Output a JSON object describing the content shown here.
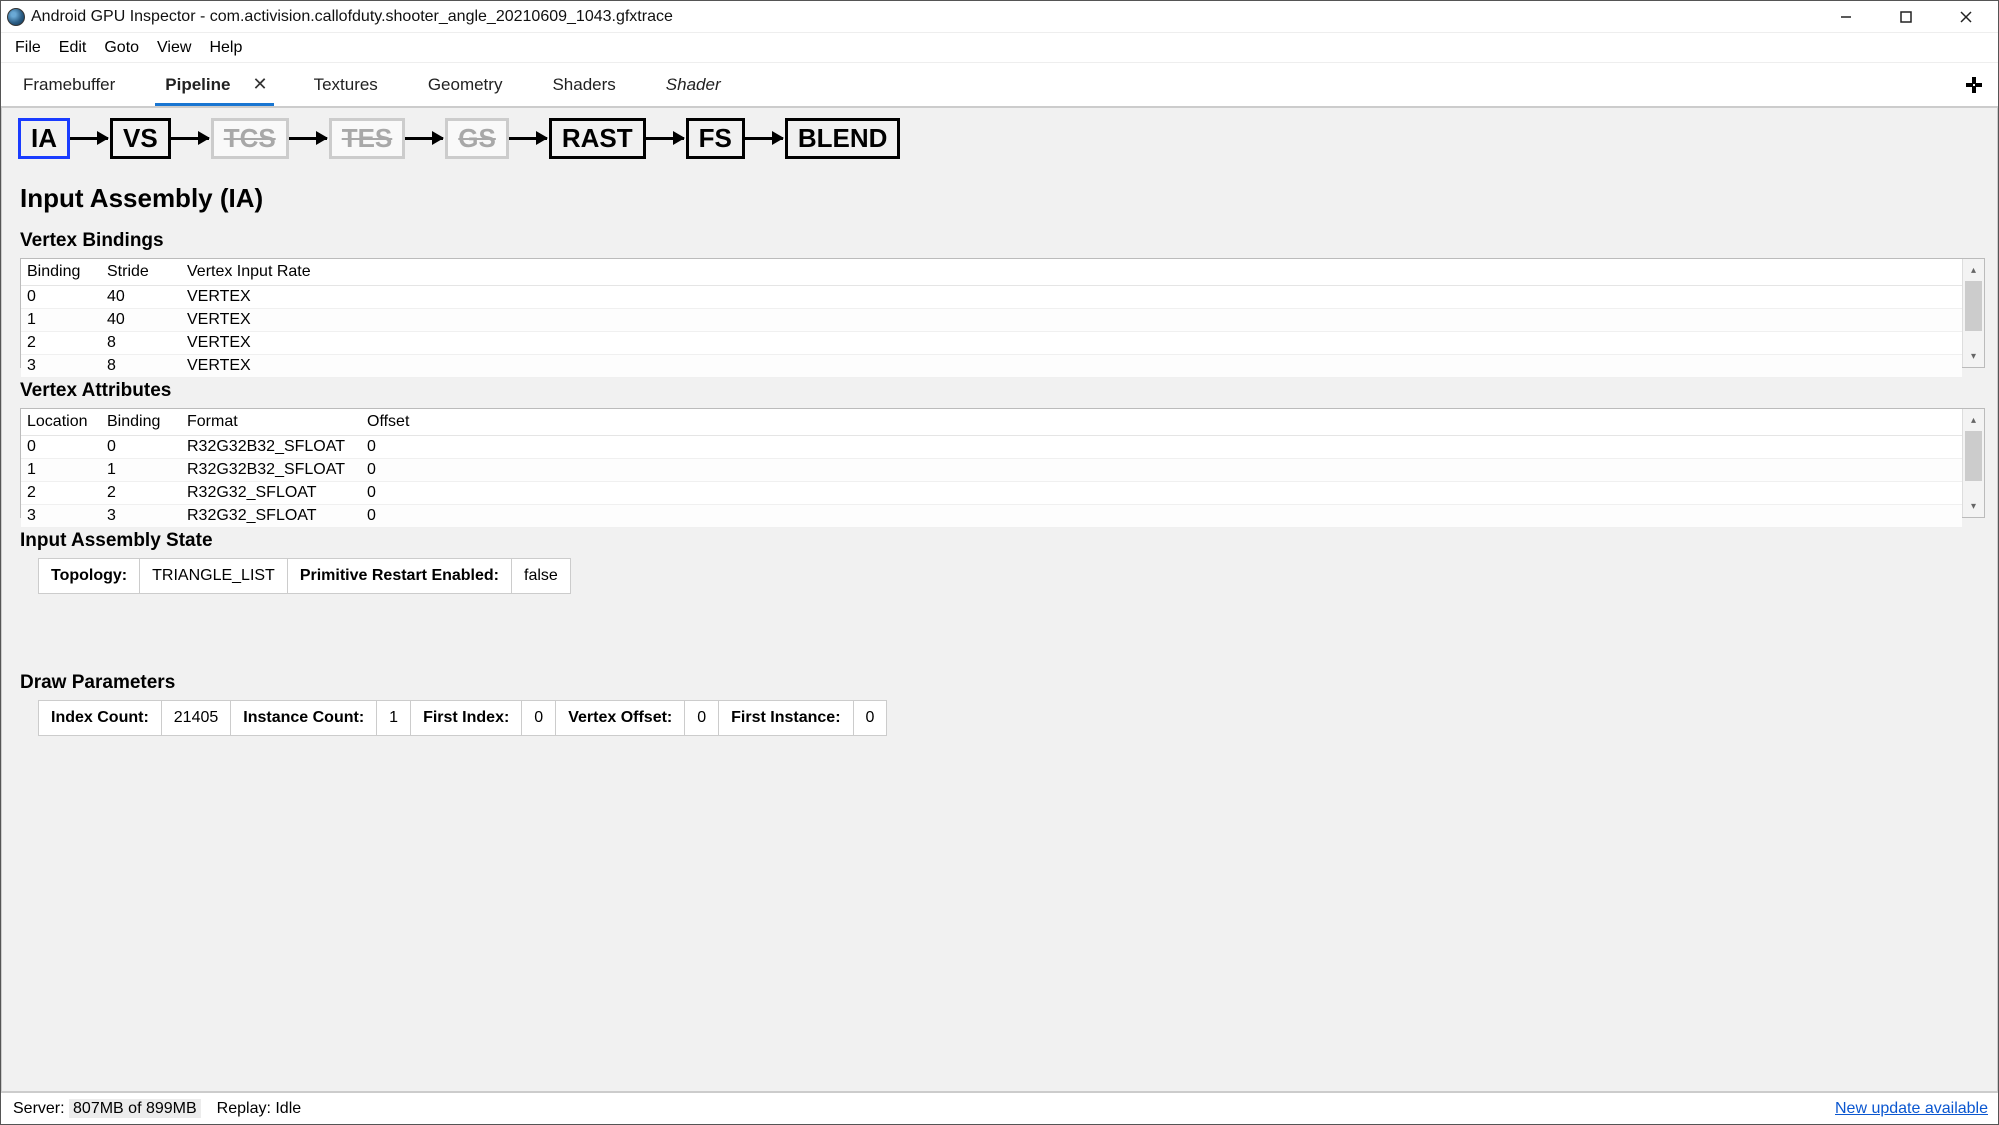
{
  "window": {
    "title": "Android GPU Inspector - com.activision.callofduty.shooter_angle_20210609_1043.gfxtrace"
  },
  "menu": {
    "items": [
      "File",
      "Edit",
      "Goto",
      "View",
      "Help"
    ]
  },
  "tabs": {
    "items": [
      {
        "label": "Framebuffer",
        "active": false
      },
      {
        "label": "Pipeline",
        "active": true,
        "closeable": true
      },
      {
        "label": "Textures",
        "active": false
      },
      {
        "label": "Geometry",
        "active": false
      },
      {
        "label": "Shaders",
        "active": false
      },
      {
        "label": "Shader",
        "active": false,
        "italic": true
      }
    ]
  },
  "pipeline_stages": [
    {
      "label": "IA",
      "selected": true,
      "enabled": true
    },
    {
      "label": "VS",
      "selected": false,
      "enabled": true
    },
    {
      "label": "TCS",
      "selected": false,
      "enabled": false
    },
    {
      "label": "TES",
      "selected": false,
      "enabled": false
    },
    {
      "label": "GS",
      "selected": false,
      "enabled": false
    },
    {
      "label": "RAST",
      "selected": false,
      "enabled": true
    },
    {
      "label": "FS",
      "selected": false,
      "enabled": true
    },
    {
      "label": "BLEND",
      "selected": false,
      "enabled": true
    }
  ],
  "section": {
    "title": "Input Assembly (IA)",
    "vertex_bindings": {
      "title": "Vertex Bindings",
      "headers": [
        "Binding",
        "Stride",
        "Vertex Input Rate"
      ],
      "rows": [
        {
          "binding": "0",
          "stride": "40",
          "rate": "VERTEX"
        },
        {
          "binding": "1",
          "stride": "40",
          "rate": "VERTEX"
        },
        {
          "binding": "2",
          "stride": "8",
          "rate": "VERTEX"
        },
        {
          "binding": "3",
          "stride": "8",
          "rate": "VERTEX"
        }
      ]
    },
    "vertex_attributes": {
      "title": "Vertex Attributes",
      "headers": [
        "Location",
        "Binding",
        "Format",
        "Offset"
      ],
      "rows": [
        {
          "location": "0",
          "binding": "0",
          "format": "R32G32B32_SFLOAT",
          "offset": "0"
        },
        {
          "location": "1",
          "binding": "1",
          "format": "R32G32B32_SFLOAT",
          "offset": "0"
        },
        {
          "location": "2",
          "binding": "2",
          "format": "R32G32_SFLOAT",
          "offset": "0"
        },
        {
          "location": "3",
          "binding": "3",
          "format": "R32G32_SFLOAT",
          "offset": "0"
        }
      ]
    },
    "input_assembly_state": {
      "title": "Input Assembly State",
      "topology_label": "Topology:",
      "topology_value": "TRIANGLE_LIST",
      "prim_restart_label": "Primitive Restart Enabled:",
      "prim_restart_value": "false"
    },
    "draw_params": {
      "title": "Draw Parameters",
      "index_count_label": "Index Count:",
      "index_count_value": "21405",
      "instance_count_label": "Instance Count:",
      "instance_count_value": "1",
      "first_index_label": "First Index:",
      "first_index_value": "0",
      "vertex_offset_label": "Vertex Offset:",
      "vertex_offset_value": "0",
      "first_instance_label": "First Instance:",
      "first_instance_value": "0"
    }
  },
  "status": {
    "server_label": "Server:",
    "server_value": "807MB of 899MB",
    "replay_label": "Replay:",
    "replay_value": "Idle",
    "update_link": "New update available"
  }
}
